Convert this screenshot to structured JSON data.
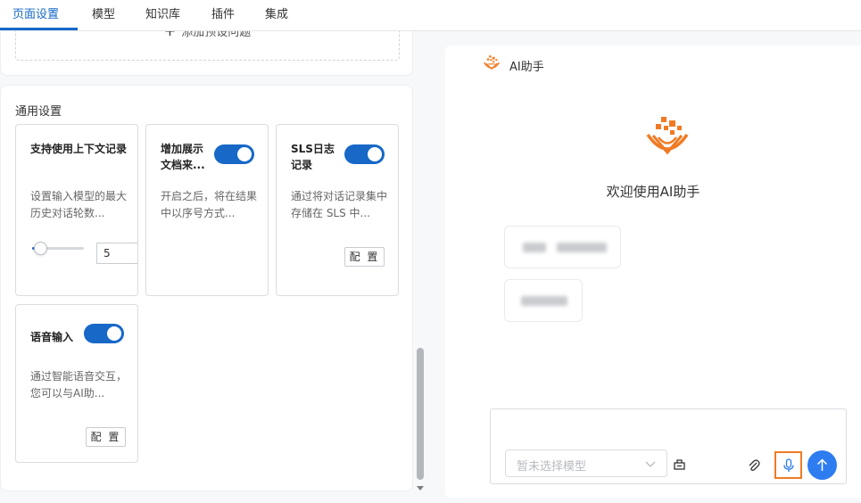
{
  "tabs": [
    {
      "label": "页面设置",
      "active": true
    },
    {
      "label": "模型",
      "active": false
    },
    {
      "label": "知识库",
      "active": false
    },
    {
      "label": "插件",
      "active": false
    },
    {
      "label": "集成",
      "active": false
    }
  ],
  "preset_questions": {
    "add_label": "添加预设问题"
  },
  "general_settings": {
    "title": "通用设置",
    "cards": [
      {
        "title": "支持使用上下文记录",
        "desc": "设置输入模型的最大历史对话轮数...",
        "slider_value": "5"
      },
      {
        "title": "增加展示文档来...",
        "desc": "开启之后，将在结果中以序号方式...",
        "enabled": true
      },
      {
        "title": "SLS日志记录",
        "desc": "通过将对话记录集中存储在 SLS 中...",
        "enabled": true,
        "config_label": "配 置"
      },
      {
        "title": "语音输入",
        "desc": "通过智能语音交互，您可以与AI助...",
        "enabled": true,
        "config_label": "配 置"
      }
    ]
  },
  "assistant": {
    "title": "AI助手",
    "welcome": "欢迎使用AI助手",
    "model_placeholder": "暂未选择模型"
  },
  "colors": {
    "accent": "#1768c7",
    "send": "#2d7cf0",
    "logo": "#f07b24",
    "highlight": "#f07b24"
  },
  "icons": [
    "plus-icon",
    "ai-logo-icon",
    "chevron-down-icon",
    "plugin-icon",
    "paperclip-icon",
    "microphone-icon",
    "arrow-up-icon"
  ]
}
